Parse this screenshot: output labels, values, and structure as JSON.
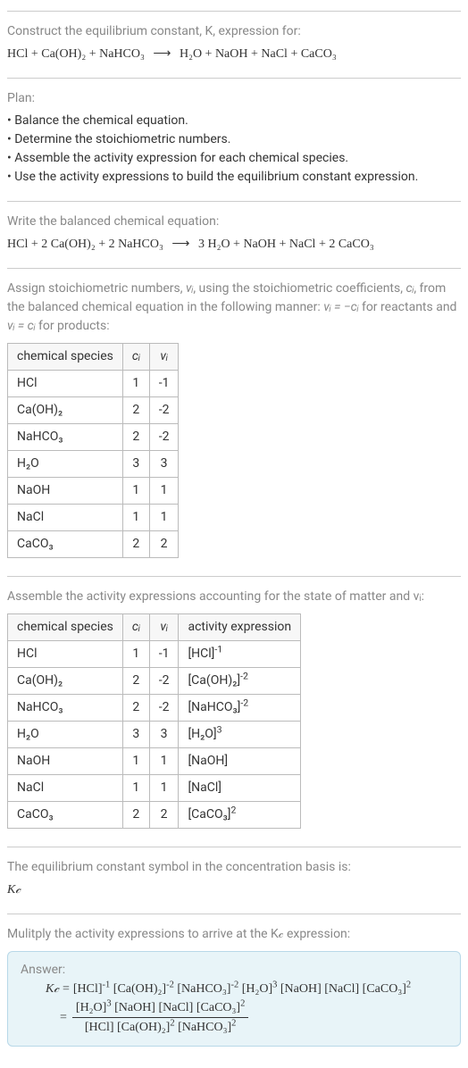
{
  "header": {
    "prompt": "Construct the equilibrium constant, K, expression for:",
    "eq_lhs": "HCl + Ca(OH)₂ + NaHCO₃",
    "arrow": "⟶",
    "eq_rhs": "H₂O + NaOH + NaCl + CaCO₃"
  },
  "plan": {
    "title": "Plan:",
    "items": [
      "Balance the chemical equation.",
      "Determine the stoichiometric numbers.",
      "Assemble the activity expression for each chemical species.",
      "Use the activity expressions to build the equilibrium constant expression."
    ]
  },
  "balanced": {
    "title": "Write the balanced chemical equation:",
    "eq_lhs": "HCl + 2 Ca(OH)₂ + 2 NaHCO₃",
    "arrow": "⟶",
    "eq_rhs": "3 H₂O + NaOH + NaCl + 2 CaCO₃"
  },
  "assign": {
    "text_a": "Assign stoichiometric numbers, ",
    "nu": "νᵢ",
    "text_b": ", using the stoichiometric coefficients, ",
    "ci": "cᵢ",
    "text_c": ", from the balanced chemical equation in the following manner: ",
    "rel1": "νᵢ = −cᵢ",
    "text_d": " for reactants and ",
    "rel2": "νᵢ = cᵢ",
    "text_e": " for products:"
  },
  "table1": {
    "headers": [
      "chemical species",
      "cᵢ",
      "νᵢ"
    ],
    "rows": [
      {
        "sp": "HCl",
        "c": "1",
        "v": "-1"
      },
      {
        "sp": "Ca(OH)₂",
        "c": "2",
        "v": "-2"
      },
      {
        "sp": "NaHCO₃",
        "c": "2",
        "v": "-2"
      },
      {
        "sp": "H₂O",
        "c": "3",
        "v": "3"
      },
      {
        "sp": "NaOH",
        "c": "1",
        "v": "1"
      },
      {
        "sp": "NaCl",
        "c": "1",
        "v": "1"
      },
      {
        "sp": "CaCO₃",
        "c": "2",
        "v": "2"
      }
    ]
  },
  "assemble": {
    "text": "Assemble the activity expressions accounting for the state of matter and νᵢ:"
  },
  "table2": {
    "headers": [
      "chemical species",
      "cᵢ",
      "νᵢ",
      "activity expression"
    ],
    "rows": [
      {
        "sp": "HCl",
        "c": "1",
        "v": "-1",
        "a_base": "[HCl]",
        "a_exp": "-1"
      },
      {
        "sp": "Ca(OH)₂",
        "c": "2",
        "v": "-2",
        "a_base": "[Ca(OH)₂]",
        "a_exp": "-2"
      },
      {
        "sp": "NaHCO₃",
        "c": "2",
        "v": "-2",
        "a_base": "[NaHCO₃]",
        "a_exp": "-2"
      },
      {
        "sp": "H₂O",
        "c": "3",
        "v": "3",
        "a_base": "[H₂O]",
        "a_exp": "3"
      },
      {
        "sp": "NaOH",
        "c": "1",
        "v": "1",
        "a_base": "[NaOH]",
        "a_exp": ""
      },
      {
        "sp": "NaCl",
        "c": "1",
        "v": "1",
        "a_base": "[NaCl]",
        "a_exp": ""
      },
      {
        "sp": "CaCO₃",
        "c": "2",
        "v": "2",
        "a_base": "[CaCO₃]",
        "a_exp": "2"
      }
    ]
  },
  "symbol": {
    "text": "The equilibrium constant symbol in the concentration basis is:",
    "kc": "K𝒸"
  },
  "multiply": {
    "text": "Mulitply the activity expressions to arrive at the K𝒸 expression:"
  },
  "answer": {
    "label": "Answer:",
    "kc": "K𝒸",
    "eq": "=",
    "terms": [
      {
        "base": "[HCl]",
        "exp": "-1"
      },
      {
        "base": "[Ca(OH)₂]",
        "exp": "-2"
      },
      {
        "base": "[NaHCO₃]",
        "exp": "-2"
      },
      {
        "base": "[H₂O]",
        "exp": "3"
      },
      {
        "base": "[NaOH]",
        "exp": ""
      },
      {
        "base": "[NaCl]",
        "exp": ""
      },
      {
        "base": "[CaCO₃]",
        "exp": "2"
      }
    ],
    "num_terms": [
      {
        "base": "[H₂O]",
        "exp": "3"
      },
      {
        "base": "[NaOH]",
        "exp": ""
      },
      {
        "base": "[NaCl]",
        "exp": ""
      },
      {
        "base": "[CaCO₃]",
        "exp": "2"
      }
    ],
    "den_terms": [
      {
        "base": "[HCl]",
        "exp": ""
      },
      {
        "base": "[Ca(OH)₂]",
        "exp": "2"
      },
      {
        "base": "[NaHCO₃]",
        "exp": "2"
      }
    ]
  },
  "chart_data": {
    "type": "table",
    "title": "Stoichiometric numbers and activity expressions",
    "tables": [
      {
        "name": "stoichiometric numbers",
        "columns": [
          "chemical species",
          "c_i",
          "nu_i"
        ],
        "rows": [
          [
            "HCl",
            1,
            -1
          ],
          [
            "Ca(OH)2",
            2,
            -2
          ],
          [
            "NaHCO3",
            2,
            -2
          ],
          [
            "H2O",
            3,
            3
          ],
          [
            "NaOH",
            1,
            1
          ],
          [
            "NaCl",
            1,
            1
          ],
          [
            "CaCO3",
            2,
            2
          ]
        ]
      },
      {
        "name": "activity expressions",
        "columns": [
          "chemical species",
          "c_i",
          "nu_i",
          "activity expression"
        ],
        "rows": [
          [
            "HCl",
            1,
            -1,
            "[HCl]^-1"
          ],
          [
            "Ca(OH)2",
            2,
            -2,
            "[Ca(OH)2]^-2"
          ],
          [
            "NaHCO3",
            2,
            -2,
            "[NaHCO3]^-2"
          ],
          [
            "H2O",
            3,
            3,
            "[H2O]^3"
          ],
          [
            "NaOH",
            1,
            1,
            "[NaOH]"
          ],
          [
            "NaCl",
            1,
            1,
            "[NaCl]"
          ],
          [
            "CaCO3",
            2,
            2,
            "[CaCO3]^2"
          ]
        ]
      }
    ],
    "balanced_equation": "HCl + 2 Ca(OH)2 + 2 NaHCO3 -> 3 H2O + NaOH + NaCl + 2 CaCO3",
    "Kc": "([H2O]^3 [NaOH] [NaCl] [CaCO3]^2) / ([HCl] [Ca(OH)2]^2 [NaHCO3]^2)"
  }
}
